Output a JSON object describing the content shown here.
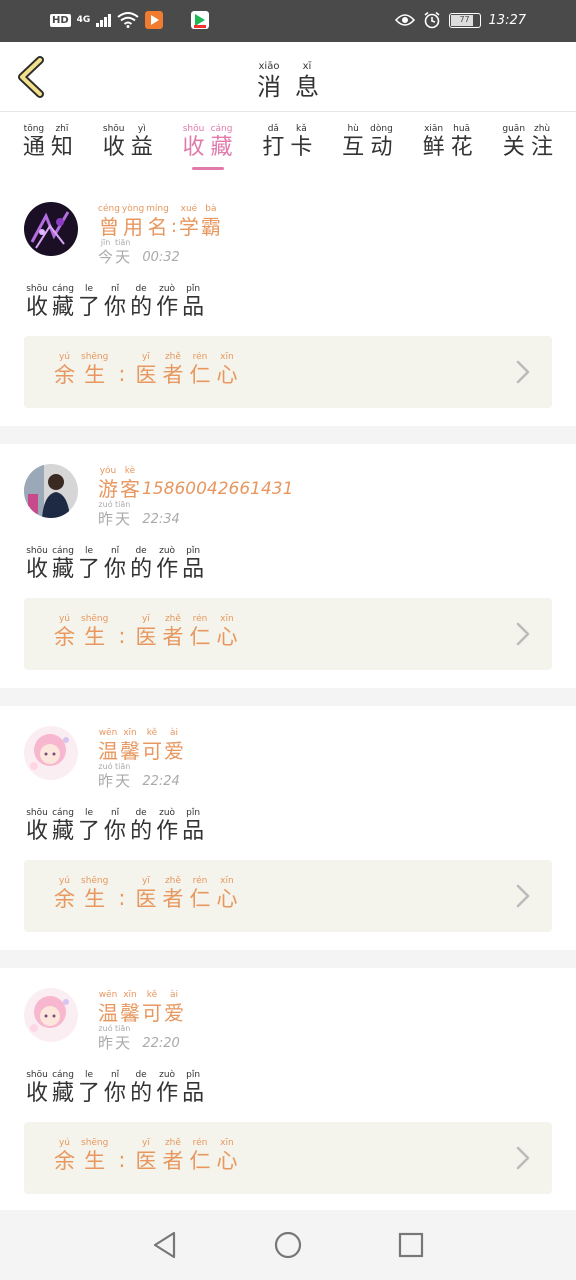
{
  "status_bar": {
    "hd": "HD",
    "network": "4G",
    "battery": "77",
    "time": "13:27",
    "icons": [
      "signal-icon",
      "wifi-icon",
      "video-app-icon",
      "play-store-icon",
      "eye-icon",
      "alarm-icon",
      "battery-icon"
    ]
  },
  "header": {
    "back_icon": "chevron-left-icon",
    "title": [
      [
        "xiāo",
        "消"
      ],
      [
        "xī",
        "息"
      ]
    ]
  },
  "tabs": [
    {
      "label": [
        [
          "tōng",
          "通"
        ],
        [
          "zhī",
          "知"
        ]
      ],
      "active": false
    },
    {
      "label": [
        [
          "shōu",
          "收"
        ],
        [
          "yì",
          "益"
        ]
      ],
      "active": false
    },
    {
      "label": [
        [
          "shōu",
          "收"
        ],
        [
          "cáng",
          "藏"
        ]
      ],
      "active": true
    },
    {
      "label": [
        [
          "dǎ",
          "打"
        ],
        [
          "kǎ",
          "卡"
        ]
      ],
      "active": false
    },
    {
      "label": [
        [
          "hù",
          "互"
        ],
        [
          "dòng",
          "动"
        ]
      ],
      "active": false
    },
    {
      "label": [
        [
          "xiān",
          "鲜"
        ],
        [
          "huā",
          "花"
        ]
      ],
      "active": false
    },
    {
      "label": [
        [
          "guān",
          "关"
        ],
        [
          "zhù",
          "注"
        ]
      ],
      "active": false
    }
  ],
  "accent_color": "#e07bab",
  "name_color": "#e8975f",
  "notifications": [
    {
      "avatar": "avatar-purple",
      "name": [
        [
          "céng",
          "曾"
        ],
        [
          "yòng",
          "用"
        ],
        [
          "míng",
          "名"
        ],
        [
          "",
          ":"
        ],
        [
          "xué",
          "学"
        ],
        [
          "bà",
          "霸"
        ]
      ],
      "name_suffix": "",
      "day": [
        [
          "jīn",
          "今"
        ],
        [
          "tiān",
          "天"
        ]
      ],
      "time": "00:32",
      "action": [
        [
          "shōu",
          "收"
        ],
        [
          "cáng",
          "藏"
        ],
        [
          "le",
          "了"
        ],
        [
          "nǐ",
          "你"
        ],
        [
          "de",
          "的"
        ],
        [
          "zuò",
          "作"
        ],
        [
          "pǐn",
          "品"
        ]
      ],
      "work": [
        [
          "yú",
          "余"
        ],
        [
          "shēng",
          "生"
        ],
        [
          "",
          ":"
        ],
        [
          "yī",
          "医"
        ],
        [
          "zhě",
          "者"
        ],
        [
          "rén",
          "仁"
        ],
        [
          "xīn",
          "心"
        ]
      ]
    },
    {
      "avatar": "avatar-dark",
      "name": [
        [
          "yóu",
          "游"
        ],
        [
          "kè",
          "客"
        ]
      ],
      "name_suffix": "15860042661431",
      "day": [
        [
          "zuó",
          "昨"
        ],
        [
          "tiān",
          "天"
        ]
      ],
      "time": "22:34",
      "action": [
        [
          "shōu",
          "收"
        ],
        [
          "cáng",
          "藏"
        ],
        [
          "le",
          "了"
        ],
        [
          "nǐ",
          "你"
        ],
        [
          "de",
          "的"
        ],
        [
          "zuò",
          "作"
        ],
        [
          "pǐn",
          "品"
        ]
      ],
      "work": [
        [
          "yú",
          "余"
        ],
        [
          "shēng",
          "生"
        ],
        [
          "",
          ":"
        ],
        [
          "yī",
          "医"
        ],
        [
          "zhě",
          "者"
        ],
        [
          "rén",
          "仁"
        ],
        [
          "xīn",
          "心"
        ]
      ]
    },
    {
      "avatar": "avatar-pink",
      "name": [
        [
          "wēn",
          "温"
        ],
        [
          "xīn",
          "馨"
        ],
        [
          "kě",
          "可"
        ],
        [
          "ài",
          "爱"
        ]
      ],
      "name_suffix": "",
      "day": [
        [
          "zuó",
          "昨"
        ],
        [
          "tiān",
          "天"
        ]
      ],
      "time": "22:24",
      "action": [
        [
          "shōu",
          "收"
        ],
        [
          "cáng",
          "藏"
        ],
        [
          "le",
          "了"
        ],
        [
          "nǐ",
          "你"
        ],
        [
          "de",
          "的"
        ],
        [
          "zuò",
          "作"
        ],
        [
          "pǐn",
          "品"
        ]
      ],
      "work": [
        [
          "yú",
          "余"
        ],
        [
          "shēng",
          "生"
        ],
        [
          "",
          ":"
        ],
        [
          "yī",
          "医"
        ],
        [
          "zhě",
          "者"
        ],
        [
          "rén",
          "仁"
        ],
        [
          "xīn",
          "心"
        ]
      ]
    },
    {
      "avatar": "avatar-pink",
      "name": [
        [
          "wēn",
          "温"
        ],
        [
          "xīn",
          "馨"
        ],
        [
          "kě",
          "可"
        ],
        [
          "ài",
          "爱"
        ]
      ],
      "name_suffix": "",
      "day": [
        [
          "zuó",
          "昨"
        ],
        [
          "tiān",
          "天"
        ]
      ],
      "time": "22:20",
      "action": [
        [
          "shōu",
          "收"
        ],
        [
          "cáng",
          "藏"
        ],
        [
          "le",
          "了"
        ],
        [
          "nǐ",
          "你"
        ],
        [
          "de",
          "的"
        ],
        [
          "zuò",
          "作"
        ],
        [
          "pǐn",
          "品"
        ]
      ],
      "work": [
        [
          "yú",
          "余"
        ],
        [
          "shēng",
          "生"
        ],
        [
          "",
          ":"
        ],
        [
          "yī",
          "医"
        ],
        [
          "zhě",
          "者"
        ],
        [
          "rén",
          "仁"
        ],
        [
          "xīn",
          "心"
        ]
      ]
    }
  ],
  "nav": [
    "back-triangle-icon",
    "home-circle-icon",
    "recents-square-icon"
  ]
}
